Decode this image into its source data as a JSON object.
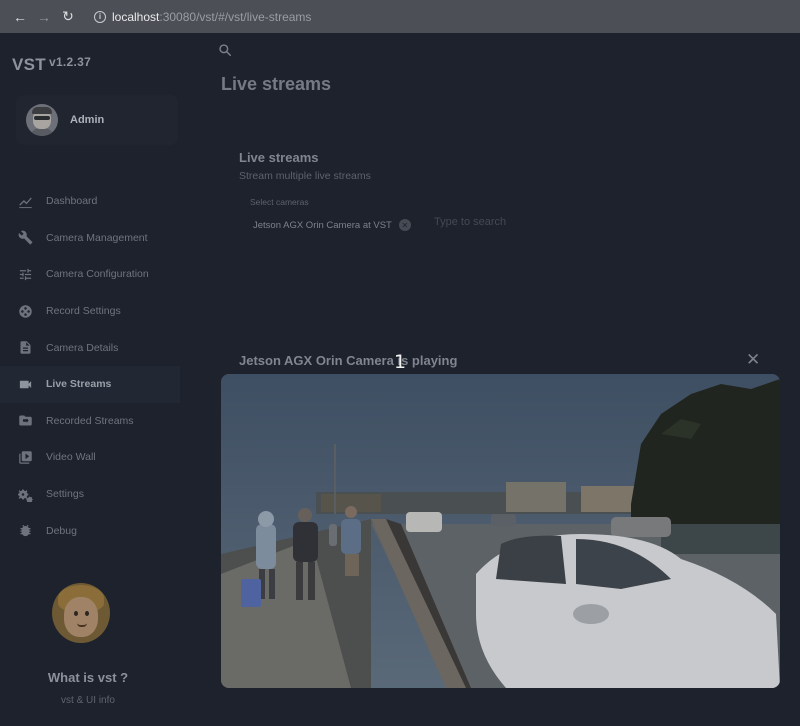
{
  "browser": {
    "url_host": "localhost",
    "url_rest": ":30080/vst/#/vst/live-streams"
  },
  "sidebar": {
    "brand": "VST",
    "version": "v1.2.37",
    "user": {
      "name": "Admin"
    },
    "items": [
      {
        "label": "Dashboard",
        "icon": "chart-line-icon",
        "active": false
      },
      {
        "label": "Camera Management",
        "icon": "wrench-icon",
        "active": false
      },
      {
        "label": "Camera Configuration",
        "icon": "sliders-icon",
        "active": false
      },
      {
        "label": "Record Settings",
        "icon": "film-reel-icon",
        "active": false
      },
      {
        "label": "Camera Details",
        "icon": "document-icon",
        "active": false
      },
      {
        "label": "Live Streams",
        "icon": "videocam-icon",
        "active": true
      },
      {
        "label": "Recorded Streams",
        "icon": "video-folder-icon",
        "active": false
      },
      {
        "label": "Video Wall",
        "icon": "video-library-icon",
        "active": false
      },
      {
        "label": "Settings",
        "icon": "gears-icon",
        "active": false
      },
      {
        "label": "Debug",
        "icon": "bug-icon",
        "active": false
      }
    ],
    "promo": {
      "title": "What is vst ?",
      "subtitle": "vst & UI info"
    }
  },
  "main": {
    "page_title": "Live streams",
    "card": {
      "title": "Live streams",
      "subtitle": "Stream multiple live streams",
      "select_label": "Select cameras",
      "selected_camera": "Jetson AGX Orin Camera at VST",
      "search_placeholder": "Type to search"
    },
    "stream": {
      "title": "Jetson AGX Orin Camera is playing",
      "overlay_number": "1"
    }
  }
}
